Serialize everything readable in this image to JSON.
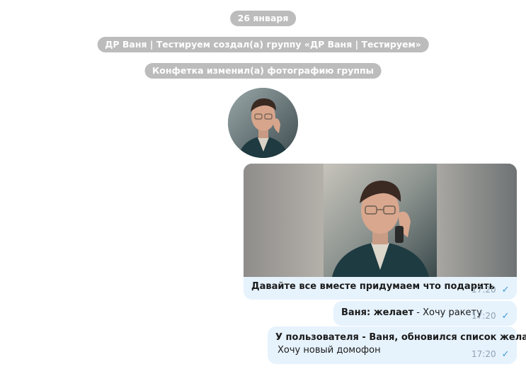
{
  "service": {
    "date": "26 января",
    "created": "ДР Ваня | Тестируем создал(а) группу «ДР Ваня | Тестируем»",
    "photo_changed": "Конфетка изменил(а) фотографию группы"
  },
  "messages": [
    {
      "caption": "Давайте все вместе придумаем что подарить",
      "time": "17:20",
      "status_icon": "single-check-icon"
    },
    {
      "sender": "Ваня: желает",
      "separator": " - ",
      "text": "Хочу ракету",
      "time": "17:20",
      "status_icon": "single-check-icon"
    },
    {
      "title": "У пользователя - Ваня, обновился список желаний",
      "text": "Хочу новый домофон",
      "time": "17:20",
      "status_icon": "single-check-icon"
    }
  ],
  "colors": {
    "service_pill": "#bcbcbc",
    "bubble": "#e6f2fc",
    "time": "#8fa2b1",
    "check": "#3f9ad8"
  }
}
